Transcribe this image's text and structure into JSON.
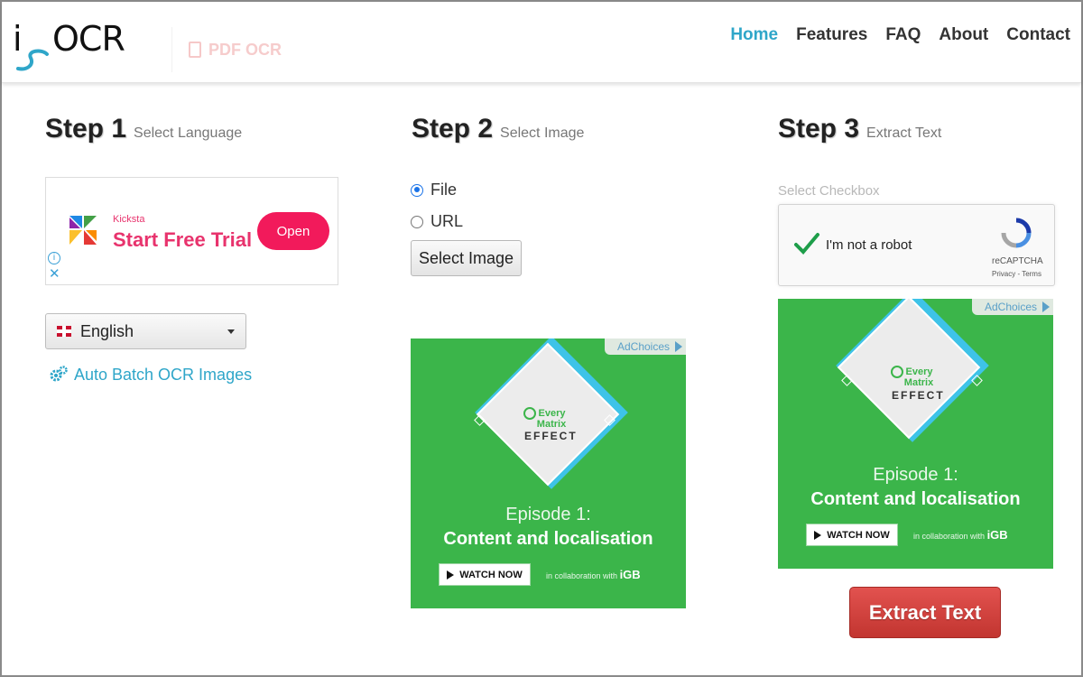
{
  "header": {
    "logo_i": "i",
    "logo_text": "OCR",
    "secondary_link": "PDF OCR",
    "nav": [
      {
        "label": "Home",
        "active": true
      },
      {
        "label": "Features",
        "active": false
      },
      {
        "label": "FAQ",
        "active": false
      },
      {
        "label": "About",
        "active": false
      },
      {
        "label": "Contact",
        "active": false
      }
    ]
  },
  "step1": {
    "title": "Step 1",
    "subtitle": "Select Language",
    "ad": {
      "brand": "Kicksta",
      "cta": "Start Free Trial",
      "button": "Open"
    },
    "language_select": {
      "value": "English"
    },
    "batch_link": "Auto Batch OCR Images"
  },
  "step2": {
    "title": "Step 2",
    "subtitle": "Select Image",
    "options": [
      {
        "label": "File",
        "checked": true
      },
      {
        "label": "URL",
        "checked": false
      }
    ],
    "select_button": "Select Image"
  },
  "step3": {
    "title": "Step 3",
    "subtitle": "Extract Text",
    "checkbox_label": "Select Checkbox",
    "recaptcha": {
      "label": "I'm not a robot",
      "brand": "reCAPTCHA",
      "terms": "Privacy - Terms"
    },
    "extract_button": "Extract Text"
  },
  "green_ad": {
    "adchoices": "AdChoices",
    "logo_line1": "Every",
    "logo_line2": "Matrix",
    "effect": "EFFECT",
    "episode": "Episode 1:",
    "subtitle": "Content and localisation",
    "watch": "WATCH NOW",
    "collab": "in collaboration with",
    "collab_brand": "iGB"
  },
  "colors": {
    "accent": "#2fa6c9",
    "ad_green": "#3bb54a",
    "extract_red": "#d9443f",
    "kicksta_pink": "#f21a5b"
  }
}
